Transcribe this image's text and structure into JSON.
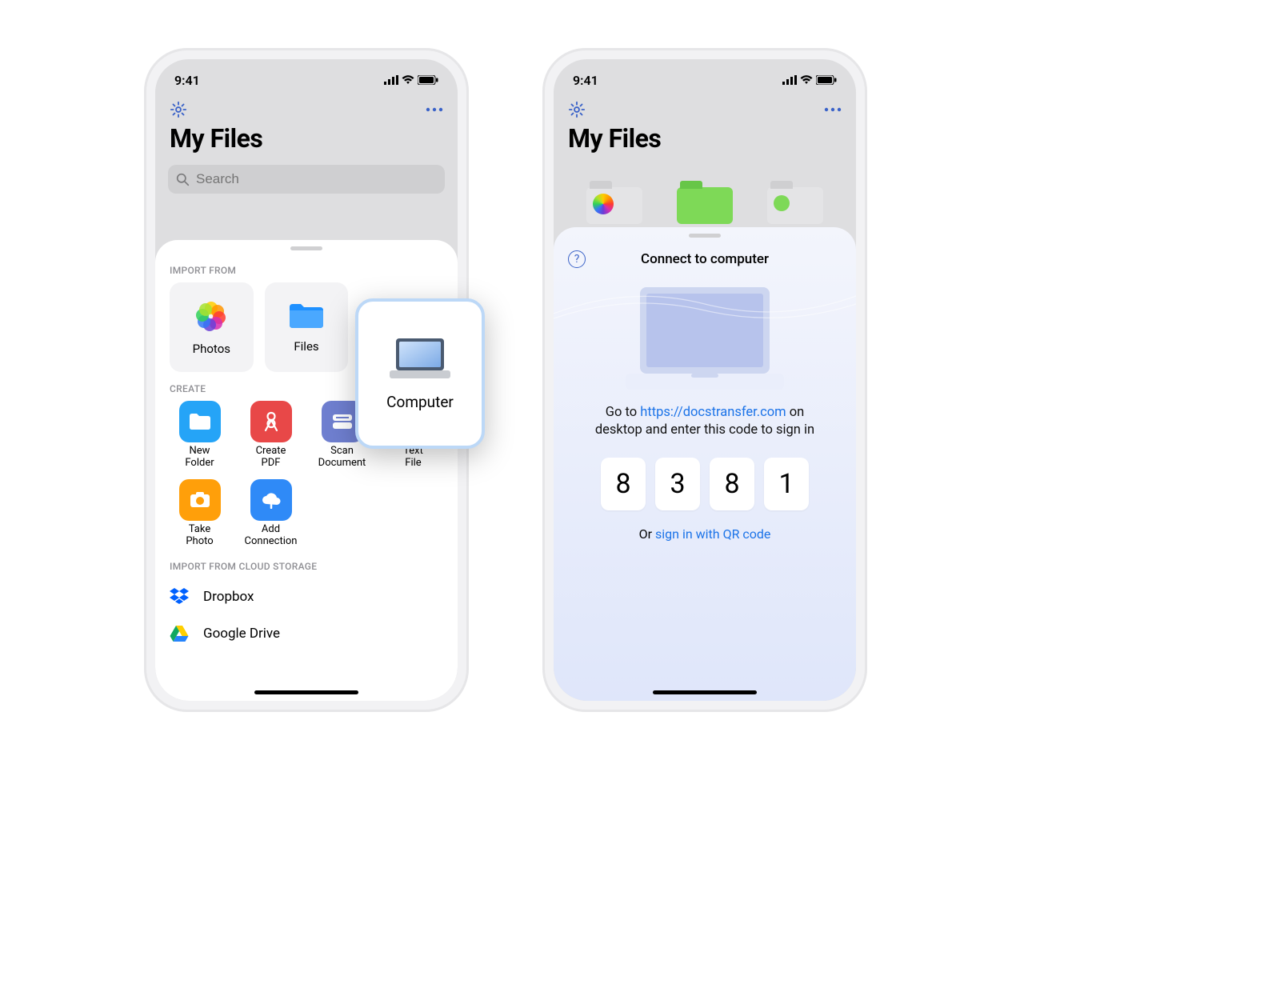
{
  "status": {
    "time": "9:41"
  },
  "header": {
    "title": "My Files"
  },
  "search": {
    "placeholder": "Search"
  },
  "sheet_left": {
    "import_label": "IMPORT FROM",
    "tiles": {
      "photos": "Photos",
      "files": "Files",
      "computer": "Computer"
    },
    "create_label": "CREATE",
    "create_items": [
      {
        "label": "New\nFolder"
      },
      {
        "label": "Create\nPDF"
      },
      {
        "label": "Scan\nDocument"
      },
      {
        "label": "Text\nFile"
      },
      {
        "label": "Take\nPhoto"
      },
      {
        "label": "Add\nConnection"
      }
    ],
    "cloud_label": "IMPORT FROM CLOUD STORAGE",
    "cloud_items": [
      {
        "label": "Dropbox"
      },
      {
        "label": "Google Drive"
      }
    ]
  },
  "sheet_right": {
    "title": "Connect to computer",
    "instruction_prefix": "Go to ",
    "url": "https://docstransfer.com",
    "instruction_suffix": " on desktop and enter this code to sign in",
    "code": [
      "8",
      "3",
      "8",
      "1"
    ],
    "or_text": "Or ",
    "or_link": "sign in with QR code"
  }
}
